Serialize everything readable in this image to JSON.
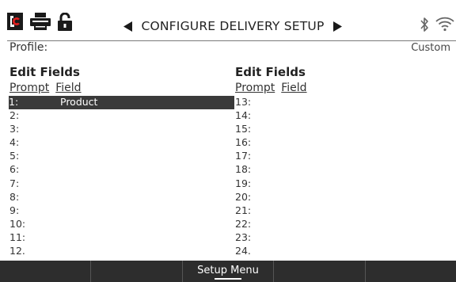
{
  "header": {
    "title": "CONFIGURE DELIVERY SETUP",
    "icons": [
      "logo-icon",
      "printer-icon",
      "unlocked-padlock-icon",
      "arrow-left-icon",
      "arrow-right-icon",
      "bluetooth-icon",
      "wifi-icon"
    ]
  },
  "profile": {
    "label": "Profile:",
    "value": "Custom"
  },
  "left_column": {
    "heading": "Edit Fields",
    "prompt_header": "Prompt",
    "field_header": "Field",
    "rows": [
      {
        "num": "1:",
        "field": "Product"
      },
      {
        "num": "2:",
        "field": ""
      },
      {
        "num": "3:",
        "field": ""
      },
      {
        "num": "4:",
        "field": ""
      },
      {
        "num": "5:",
        "field": ""
      },
      {
        "num": "6:",
        "field": ""
      },
      {
        "num": "7:",
        "field": ""
      },
      {
        "num": "8:",
        "field": ""
      },
      {
        "num": "9:",
        "field": ""
      },
      {
        "num": "10:",
        "field": ""
      },
      {
        "num": "11:",
        "field": ""
      },
      {
        "num": "12.",
        "field": ""
      }
    ]
  },
  "right_column": {
    "heading": "Edit Fields",
    "prompt_header": "Prompt",
    "field_header": "Field",
    "rows": [
      {
        "num": "13:",
        "field": ""
      },
      {
        "num": "14:",
        "field": ""
      },
      {
        "num": "15:",
        "field": ""
      },
      {
        "num": "16:",
        "field": ""
      },
      {
        "num": "17:",
        "field": ""
      },
      {
        "num": "18:",
        "field": ""
      },
      {
        "num": "19:",
        "field": ""
      },
      {
        "num": "20:",
        "field": ""
      },
      {
        "num": "21:",
        "field": ""
      },
      {
        "num": "22:",
        "field": ""
      },
      {
        "num": "23:",
        "field": ""
      },
      {
        "num": "24.",
        "field": ""
      }
    ]
  },
  "selected_row": 1,
  "softkeys": [
    "",
    "",
    "Setup Menu",
    "",
    ""
  ],
  "colors": {
    "selection_bg": "#3a3a3a",
    "softkey_bar_bg": "#2d2d2d",
    "text": "#2a2a2a"
  }
}
